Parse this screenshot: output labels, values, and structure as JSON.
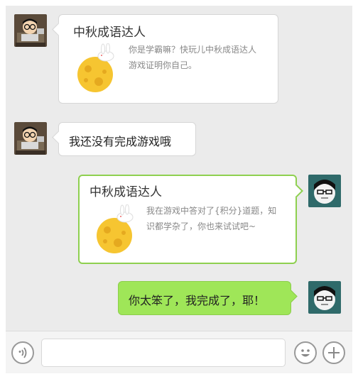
{
  "messages": [
    {
      "type": "card",
      "side": "left",
      "sender": "nerd-boy-avatar",
      "title": "中秋成语达人",
      "desc_line1": "你是学霸嘛？快玩儿中秋成语达人",
      "desc_line2": "游戏证明你自己。"
    },
    {
      "type": "text",
      "side": "left",
      "sender": "nerd-boy-avatar",
      "text": "我还没有完成游戏哦"
    },
    {
      "type": "card",
      "side": "right",
      "sender": "self-avatar",
      "title": "中秋成语达人",
      "desc_line1": "我在游戏中答对了{积分}道题，知",
      "desc_line2": "识都学杂了，你也来试试吧~"
    },
    {
      "type": "text",
      "side": "right",
      "sender": "self-avatar",
      "text": "你太笨了，我完成了，耶！"
    }
  ],
  "input_bar": {
    "voice_icon": "voice-icon",
    "text_value": "",
    "emoji_icon": "smiley-icon",
    "plus_icon": "plus-icon"
  },
  "colors": {
    "chat_bg": "#ebebeb",
    "self_bubble": "#9fe658",
    "card_border_self": "#8ed04f"
  }
}
